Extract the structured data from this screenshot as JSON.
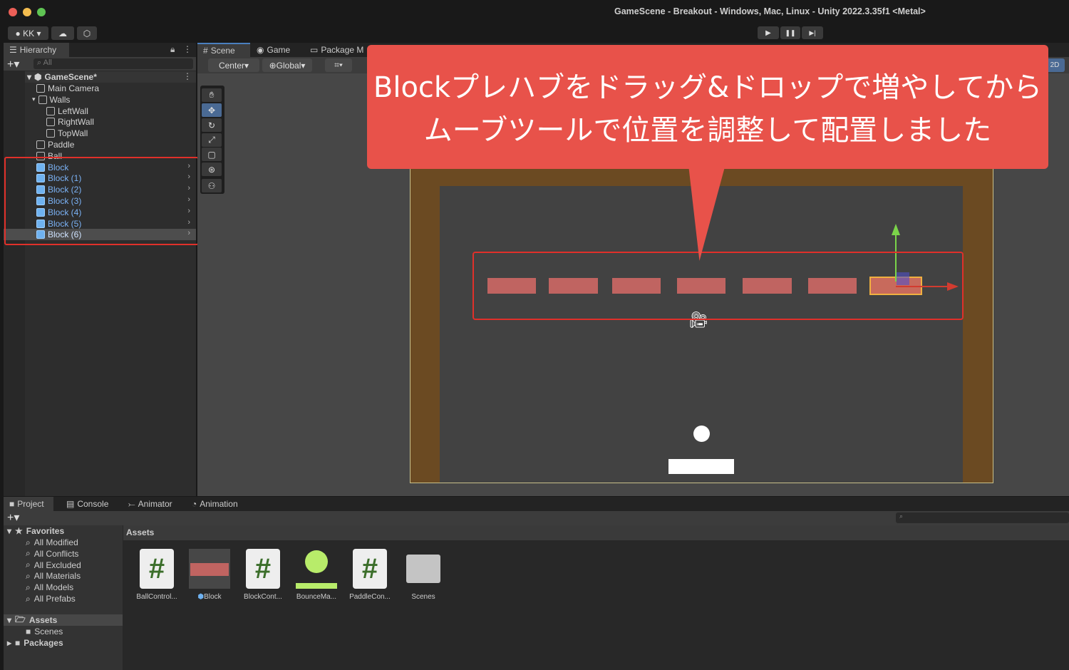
{
  "window": {
    "title": "GameScene - Breakout - Windows, Mac, Linux - Unity 2022.3.35f1 <Metal>"
  },
  "toolbar": {
    "account": "KK",
    "play": "▶",
    "pause": "❚❚",
    "step": "▶|"
  },
  "hierarchy": {
    "tab": "Hierarchy",
    "search_placeholder": "All",
    "scene": "GameScene*",
    "items": [
      {
        "label": "Main Camera",
        "depth": 1
      },
      {
        "label": "Walls",
        "depth": 1
      },
      {
        "label": "LeftWall",
        "depth": 2
      },
      {
        "label": "RightWall",
        "depth": 2
      },
      {
        "label": "TopWall",
        "depth": 2
      },
      {
        "label": "Paddle",
        "depth": 1
      },
      {
        "label": "Ball",
        "depth": 1
      },
      {
        "label": "Block",
        "depth": 1,
        "prefab": true
      },
      {
        "label": "Block (1)",
        "depth": 1,
        "prefab": true
      },
      {
        "label": "Block (2)",
        "depth": 1,
        "prefab": true
      },
      {
        "label": "Block (3)",
        "depth": 1,
        "prefab": true
      },
      {
        "label": "Block (4)",
        "depth": 1,
        "prefab": true
      },
      {
        "label": "Block (5)",
        "depth": 1,
        "prefab": true
      },
      {
        "label": "Block (6)",
        "depth": 1,
        "prefab": true,
        "selected": true
      }
    ]
  },
  "scene": {
    "tabs": [
      "Scene",
      "Game",
      "Package M"
    ],
    "pivot": "Center",
    "space": "Global",
    "mode_2d": "2D"
  },
  "callout": {
    "line1": "Blockプレハブをドラッグ&ドロップで増やしてから",
    "line2": "ムーブツールで位置を調整して配置しました",
    "color": "#e8524a"
  },
  "bottom": {
    "tabs": [
      "Project",
      "Console",
      "Animator",
      "Animation"
    ],
    "favorites": {
      "label": "Favorites",
      "items": [
        "All Modified",
        "All Conflicts",
        "All Excluded",
        "All Materials",
        "All Models",
        "All Prefabs"
      ]
    },
    "tree": {
      "assets": "Assets",
      "scenes": "Scenes",
      "packages": "Packages"
    },
    "breadcrumb": "Assets",
    "assets": [
      "BallControl...",
      "Block",
      "BlockCont...",
      "BounceMa...",
      "PaddleCon...",
      "Scenes"
    ]
  },
  "colors": {
    "block": "#c06461",
    "wall": "#6b4a22",
    "highlight": "#e0302a"
  }
}
